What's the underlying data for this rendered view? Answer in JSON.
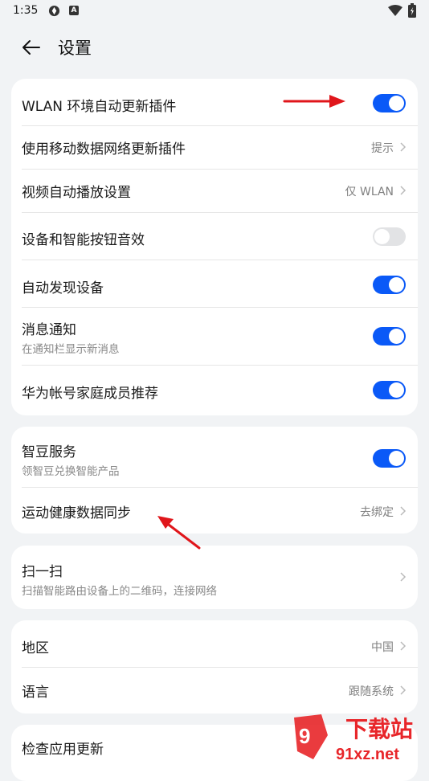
{
  "status_bar": {
    "time": "1:35",
    "icon_a_letter": "A"
  },
  "header": {
    "title": "设置"
  },
  "group1": [
    {
      "label": "WLAN 环境自动更新插件",
      "control": "toggle",
      "on": true
    },
    {
      "label": "使用移动数据网络更新插件",
      "value": "提示"
    },
    {
      "label": "视频自动播放设置",
      "value": "仅 WLAN"
    },
    {
      "label": "设备和智能按钮音效",
      "control": "toggle",
      "on": false
    },
    {
      "label": "自动发现设备",
      "control": "toggle",
      "on": true
    },
    {
      "label": "消息通知",
      "sub": "在通知栏显示新消息",
      "control": "toggle",
      "on": true
    },
    {
      "label": "华为帐号家庭成员推荐",
      "control": "toggle",
      "on": true
    }
  ],
  "group2": [
    {
      "label": "智豆服务",
      "sub": "领智豆兑换智能产品",
      "control": "toggle",
      "on": true
    },
    {
      "label": "运动健康数据同步",
      "value": "去绑定"
    }
  ],
  "group3": [
    {
      "label": "扫一扫",
      "sub": "扫描智能路由设备上的二维码，连接网络"
    }
  ],
  "group4": [
    {
      "label": "地区",
      "value": "中国"
    },
    {
      "label": "语言",
      "value": "跟随系统"
    }
  ],
  "group5": [
    {
      "label": "检查应用更新"
    }
  ],
  "watermark": {
    "text_top": "下载站",
    "text_bottom": "91xz.net"
  },
  "colors": {
    "accent": "#0a59f7",
    "background": "#f1f3f5",
    "arrow": "#e0161b"
  },
  "icons": [
    "back-arrow-icon",
    "chevron-right-icon",
    "wifi-icon",
    "battery-icon",
    "shield-icon"
  ]
}
